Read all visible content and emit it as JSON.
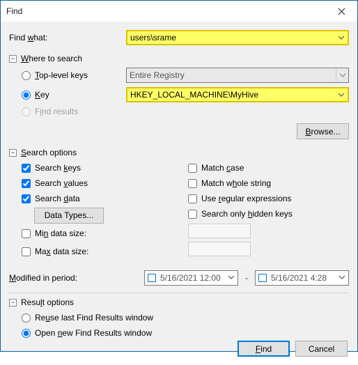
{
  "titlebar": {
    "title": "Find"
  },
  "find_what": {
    "label_pre": "Find ",
    "label_u": "w",
    "label_post": "hat:",
    "value": "users\\srame"
  },
  "where": {
    "section_u": "W",
    "section_post": "here to search",
    "top_u": "T",
    "top_post": "op-level keys",
    "key_u": "K",
    "key_post": "ey",
    "find_results_pre": "F",
    "find_results_u": "i",
    "find_results_post": "nd results",
    "entire_registry": "Entire Registry",
    "key_value": "HKEY_LOCAL_MACHINE\\MyHive",
    "browse_u": "B",
    "browse_post": "rowse..."
  },
  "search_options": {
    "section_u": "S",
    "section_post": "earch options",
    "keys_pre": "Search ",
    "keys_u": "k",
    "keys_post": "eys",
    "values_pre": "Search ",
    "values_u": "v",
    "values_post": "alues",
    "data_pre": "Search ",
    "data_u": "d",
    "data_post": "ata",
    "types": "Data Types...",
    "min_pre": "Mi",
    "min_u": "n",
    "min_post": " data size:",
    "max_pre": "Ma",
    "max_u": "x",
    "max_post": " data size:",
    "match_case_pre": "Match ",
    "match_case_u": "c",
    "match_case_post": "ase",
    "whole_pre": "Match w",
    "whole_u": "h",
    "whole_post": "ole string",
    "regex_pre": "Use ",
    "regex_u": "r",
    "regex_post": "egular expressions",
    "hidden_pre": "Search only ",
    "hidden_u": "h",
    "hidden_post": "idden keys"
  },
  "modified": {
    "label_u": "M",
    "label_post": "odified in period:",
    "from": "5/16/2021 12:00",
    "to": "5/16/2021  4:28"
  },
  "result": {
    "section_pre": "Resu",
    "section_u": "l",
    "section_post": "t options",
    "reuse_pre": "Re",
    "reuse_u": "u",
    "reuse_post": "se last Find Results window",
    "new_pre": "Open ",
    "new_u": "n",
    "new_post": "ew Find Results window"
  },
  "buttons": {
    "find_u": "F",
    "find_post": "ind",
    "cancel": "Cancel"
  }
}
